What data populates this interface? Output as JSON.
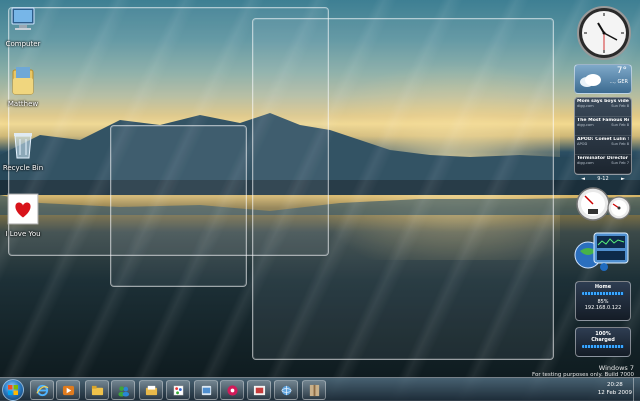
{
  "desktop": {
    "icons": [
      {
        "label": "Computer"
      },
      {
        "label": "Matthew"
      },
      {
        "label": "Recycle Bin"
      },
      {
        "label": "I Love You",
        "image_text": [
          "I Love You"
        ]
      }
    ]
  },
  "gadgets": {
    "weather": {
      "temp": "7°",
      "location": "..., GER"
    },
    "feeds": {
      "items": [
        {
          "title": "Mom says boys vide...",
          "source": "digg.com",
          "date": "Sun Feb 8"
        },
        {
          "title": "The Most Famous Re...",
          "source": "digg.com",
          "date": "Sun Feb 8"
        },
        {
          "title": "APOD: Comet Lulin T...",
          "source": "APOD",
          "date": "Sun Feb 8"
        },
        {
          "title": "Terminator Director ...",
          "source": "digg.com",
          "date": "Sun Feb 7"
        }
      ],
      "nav_prev": "◄",
      "page": "9-12",
      "nav_next": "►"
    },
    "network": {
      "title": "Home",
      "signal": "85%",
      "ip": "192.168.0.122",
      "signal_fraction": 0.85
    },
    "battery": {
      "percent": "100%",
      "status": "Charged",
      "fraction": 1.0
    }
  },
  "watermark": {
    "line1": "Windows 7",
    "line2": "For testing purposes only. Build 7000"
  },
  "taskbar": {
    "buttons": [
      {
        "icon": "internet-explorer-icon"
      },
      {
        "icon": "media-player-icon"
      },
      {
        "icon": "explorer-folder-icon"
      },
      {
        "icon": "messenger-icon"
      },
      {
        "icon": "folder-icon"
      },
      {
        "icon": "paint-icon"
      },
      {
        "icon": "windows-app-icon"
      },
      {
        "icon": "media-center-icon"
      },
      {
        "icon": "image-editor-icon"
      },
      {
        "icon": "network-icon"
      },
      {
        "icon": "pictures-icon"
      }
    ],
    "clock": {
      "time": "20:28",
      "date": "12 Feb 2009"
    }
  },
  "colors": {
    "accent": "#39a6ff",
    "taskbar": "#1e2d3a"
  }
}
